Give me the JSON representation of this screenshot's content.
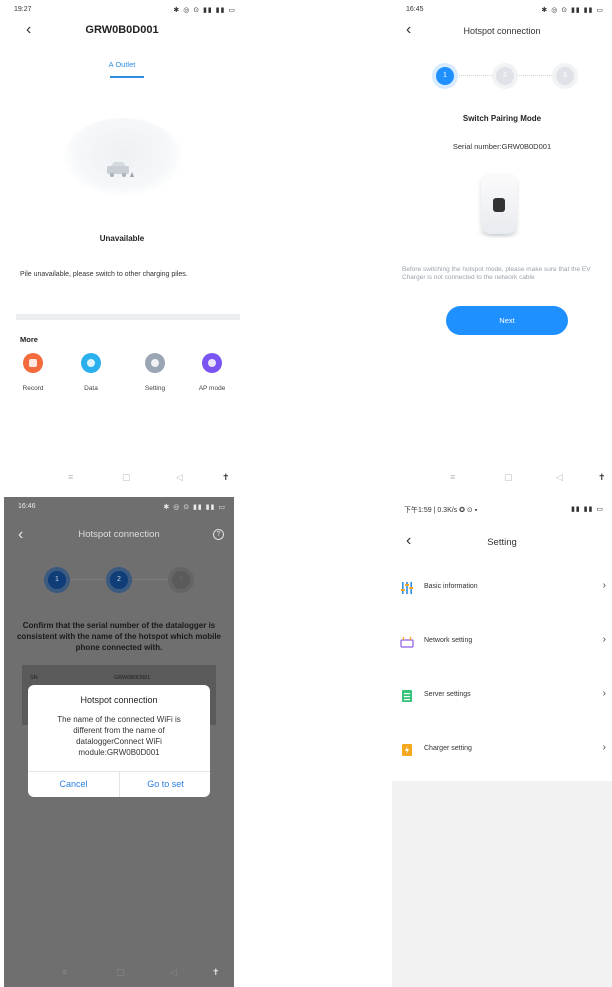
{
  "panel1": {
    "status": {
      "time": "19:27",
      "icons": "✱ ◎ ⊙ ▮▮ ▮▮ ▭"
    },
    "title": "GRW0B0D001",
    "tab": "A Outlet",
    "status_text": "Unavailable",
    "message": "Pile unavailable, please switch to other charging piles.",
    "more_label": "More",
    "buttons": [
      {
        "label": "Record",
        "color": "#f36b3c"
      },
      {
        "label": "Data",
        "color": "#2bb0ee"
      },
      {
        "label": "Setting",
        "color": "#9aa6b4"
      },
      {
        "label": "AP mode",
        "color": "#7a55f2"
      }
    ],
    "nav": [
      "≡",
      "▢",
      "◁",
      "✝"
    ]
  },
  "panel2": {
    "status": {
      "time": "16:45",
      "icons": "✱ ◎ ⊙ ▮▮ ▮▮ ▭"
    },
    "title": "Hotspot connection",
    "steps": [
      "1",
      "2",
      "3"
    ],
    "heading": "Switch Pairing Mode",
    "serial": "Serial number:GRW0B0D001",
    "note": "Before switching the hotspot mode, please make sure that the EV Charger is not connected to the network cable",
    "next_label": "Next",
    "accent": "#1e90ff",
    "nav": [
      "≡",
      "▢",
      "◁",
      "✝"
    ]
  },
  "panel3": {
    "status": {
      "time": "16:46",
      "icons": "✱ ◎ ⊙ ▮▮ ▮▮ ▭"
    },
    "title": "Hotspot connection",
    "help": "?",
    "steps": [
      "1",
      "2",
      "3"
    ],
    "confirm": "Confirm that the serial number of the datalogger is consistent with the name of the hotspot which mobile phone connected with.",
    "sn_label": "SN",
    "sn_value": "GRW0B0D001",
    "dialog": {
      "title": "Hotspot connection",
      "body": "The name of the connected WiFi is different from the name of dataloggerConnect WiFi module:GRW0B0D001",
      "cancel": "Cancel",
      "go": "Go to set"
    },
    "nav": [
      "≡",
      "▢",
      "◁",
      "✝"
    ]
  },
  "panel4": {
    "status": {
      "time": "下午1:59 | 0.3K/s ✪ ⊙ ▪",
      "icons": "▮▮ ▮▮ ▭"
    },
    "title": "Setting",
    "rows": [
      {
        "label": "Basic information",
        "icon": "sliders-icon",
        "color": "#2f8ee6"
      },
      {
        "label": "Network setting",
        "icon": "router-icon",
        "color": "#8e5ce6"
      },
      {
        "label": "Server settings",
        "icon": "server-icon",
        "color": "#37c27a"
      },
      {
        "label": "Charger setting",
        "icon": "charger-icon",
        "color": "#f3a81e"
      }
    ],
    "chevron": "›"
  }
}
